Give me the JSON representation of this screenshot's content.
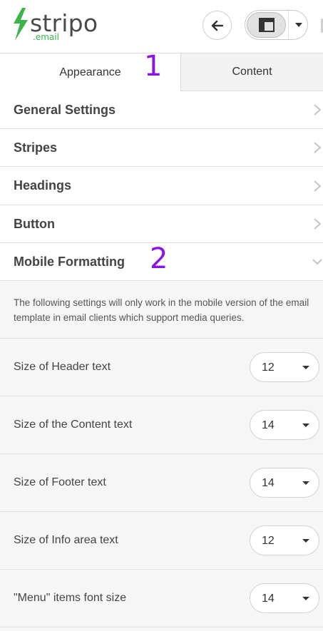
{
  "logo": {
    "name": "stripo",
    "sub": ".email",
    "brand_color": "#3bb54a"
  },
  "toolbar": {
    "back_icon": "arrow-left-icon",
    "layout_icon": "layout-icon",
    "dropdown_icon": "caret-down-icon"
  },
  "tabs": [
    {
      "label": "Appearance",
      "active": true
    },
    {
      "label": "Content",
      "active": false
    }
  ],
  "annotations": {
    "one": "1",
    "two": "2",
    "color": "#8a14e8"
  },
  "sections": [
    {
      "title": "General Settings",
      "state": "collapsed"
    },
    {
      "title": "Stripes",
      "state": "collapsed"
    },
    {
      "title": "Headings",
      "state": "collapsed"
    },
    {
      "title": "Button",
      "state": "collapsed"
    },
    {
      "title": "Mobile Formatting",
      "state": "expanded"
    }
  ],
  "mobile_formatting": {
    "note": "The following settings will only work in the mobile version of the email template in email clients which support media queries.",
    "rows": [
      {
        "label": "Size of Header text",
        "value": "12"
      },
      {
        "label": "Size of the Content text",
        "value": "14"
      },
      {
        "label": "Size of Footer text",
        "value": "14"
      },
      {
        "label": "Size of Info area text",
        "value": "12"
      },
      {
        "label": "\"Menu\" items font size",
        "value": "14"
      }
    ]
  }
}
